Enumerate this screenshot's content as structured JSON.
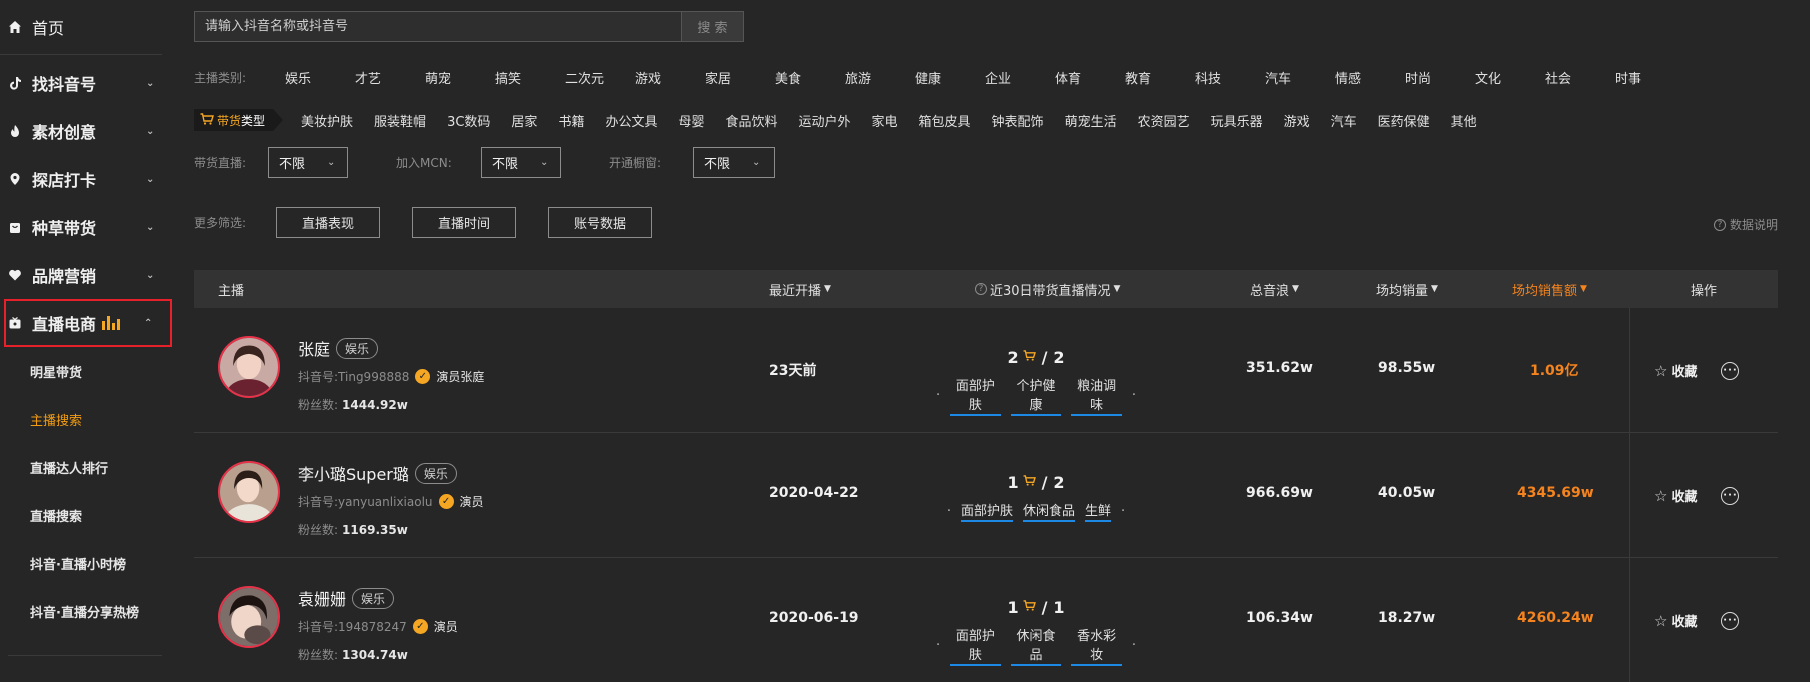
{
  "sidebar": {
    "home": "首页",
    "groups": [
      {
        "label": "找抖音号",
        "icon": "tiktok-icon"
      },
      {
        "label": "素材创意",
        "icon": "fire-icon"
      },
      {
        "label": "探店打卡",
        "icon": "location-pin-icon"
      },
      {
        "label": "种草带货",
        "icon": "bag-icon"
      },
      {
        "label": "品牌营销",
        "icon": "heart-icon"
      }
    ],
    "active_group": "直播电商",
    "sub_items": [
      "明星带货",
      "主播搜索",
      "直播达人排行",
      "直播搜索",
      "抖音·直播小时榜",
      "抖音·直播分享热榜"
    ],
    "current_sub_item": "主播搜索",
    "accent_color": "#f39c12",
    "highlight_border_color": "#e8202a"
  },
  "search": {
    "placeholder": "请输入抖音名称或抖音号",
    "button_label": "搜 索"
  },
  "filters": {
    "anchor_category_label": "主播类别:",
    "anchor_categories": [
      "娱乐",
      "才艺",
      "萌宠",
      "搞笑",
      "二次元",
      "游戏",
      "家居",
      "美食",
      "旅游",
      "健康",
      "企业",
      "体育",
      "教育",
      "科技",
      "汽车",
      "情感",
      "时尚",
      "文化",
      "社会",
      "时事"
    ],
    "goods_type_label_a": "带货",
    "goods_type_label_b": "类型",
    "goods_types": [
      "美妆护肤",
      "服装鞋帽",
      "3C数码",
      "居家",
      "书籍",
      "办公文具",
      "母婴",
      "食品饮料",
      "运动户外",
      "家电",
      "箱包皮具",
      "钟表配饰",
      "萌宠生活",
      "农资园艺",
      "玩具乐器",
      "游戏",
      "汽车",
      "医药保健",
      "其他"
    ],
    "live_goods_label": "带货直播:",
    "live_goods_value": "不限",
    "mcn_label": "加入MCN:",
    "mcn_value": "不限",
    "window_label": "开通橱窗:",
    "window_value": "不限",
    "more_label": "更多筛选:",
    "more_buttons": [
      "直播表现",
      "直播时间",
      "账号数据"
    ],
    "data_note": "数据说明"
  },
  "table": {
    "headers": {
      "anchor": "主播",
      "recent": "最近开播",
      "live30": "近30日带货直播情况",
      "total_sound": "总音浪",
      "avg_sales": "场均销量",
      "avg_amount": "场均销售额",
      "ops": "操作"
    },
    "rows": [
      {
        "name": "张庭",
        "category": "娱乐",
        "id": "抖音号:Ting998888",
        "verify": "演员张庭",
        "fans_label": "粉丝数:",
        "fans": "1444.92w",
        "recent": "23天前",
        "live_with_goods": "2",
        "live_total": "2",
        "live_cats": [
          "面部护肤",
          "个护健康",
          "粮油调味"
        ],
        "total_sound": "351.62w",
        "avg_sales": "98.55w",
        "avg_amount": "1.09亿",
        "fav": "收藏"
      },
      {
        "name": "李小璐Super璐",
        "category": "娱乐",
        "id": "抖音号:yanyuanlixiaolu",
        "verify": "演员",
        "fans_label": "粉丝数:",
        "fans": "1169.35w",
        "recent": "2020-04-22",
        "live_with_goods": "1",
        "live_total": "2",
        "live_cats": [
          "面部护肤",
          "休闲食品",
          "生鲜"
        ],
        "total_sound": "966.69w",
        "avg_sales": "40.05w",
        "avg_amount": "4345.69w",
        "fav": "收藏"
      },
      {
        "name": "袁姗姗",
        "category": "娱乐",
        "id": "抖音号:194878247",
        "verify": "演员",
        "fans_label": "粉丝数:",
        "fans": "1304.74w",
        "recent": "2020-06-19",
        "live_with_goods": "1",
        "live_total": "1",
        "live_cats": [
          "面部护肤",
          "休闲食品",
          "香水彩妆"
        ],
        "total_sound": "106.34w",
        "avg_sales": "18.27w",
        "avg_amount": "4260.24w",
        "fav": "收藏"
      }
    ]
  }
}
